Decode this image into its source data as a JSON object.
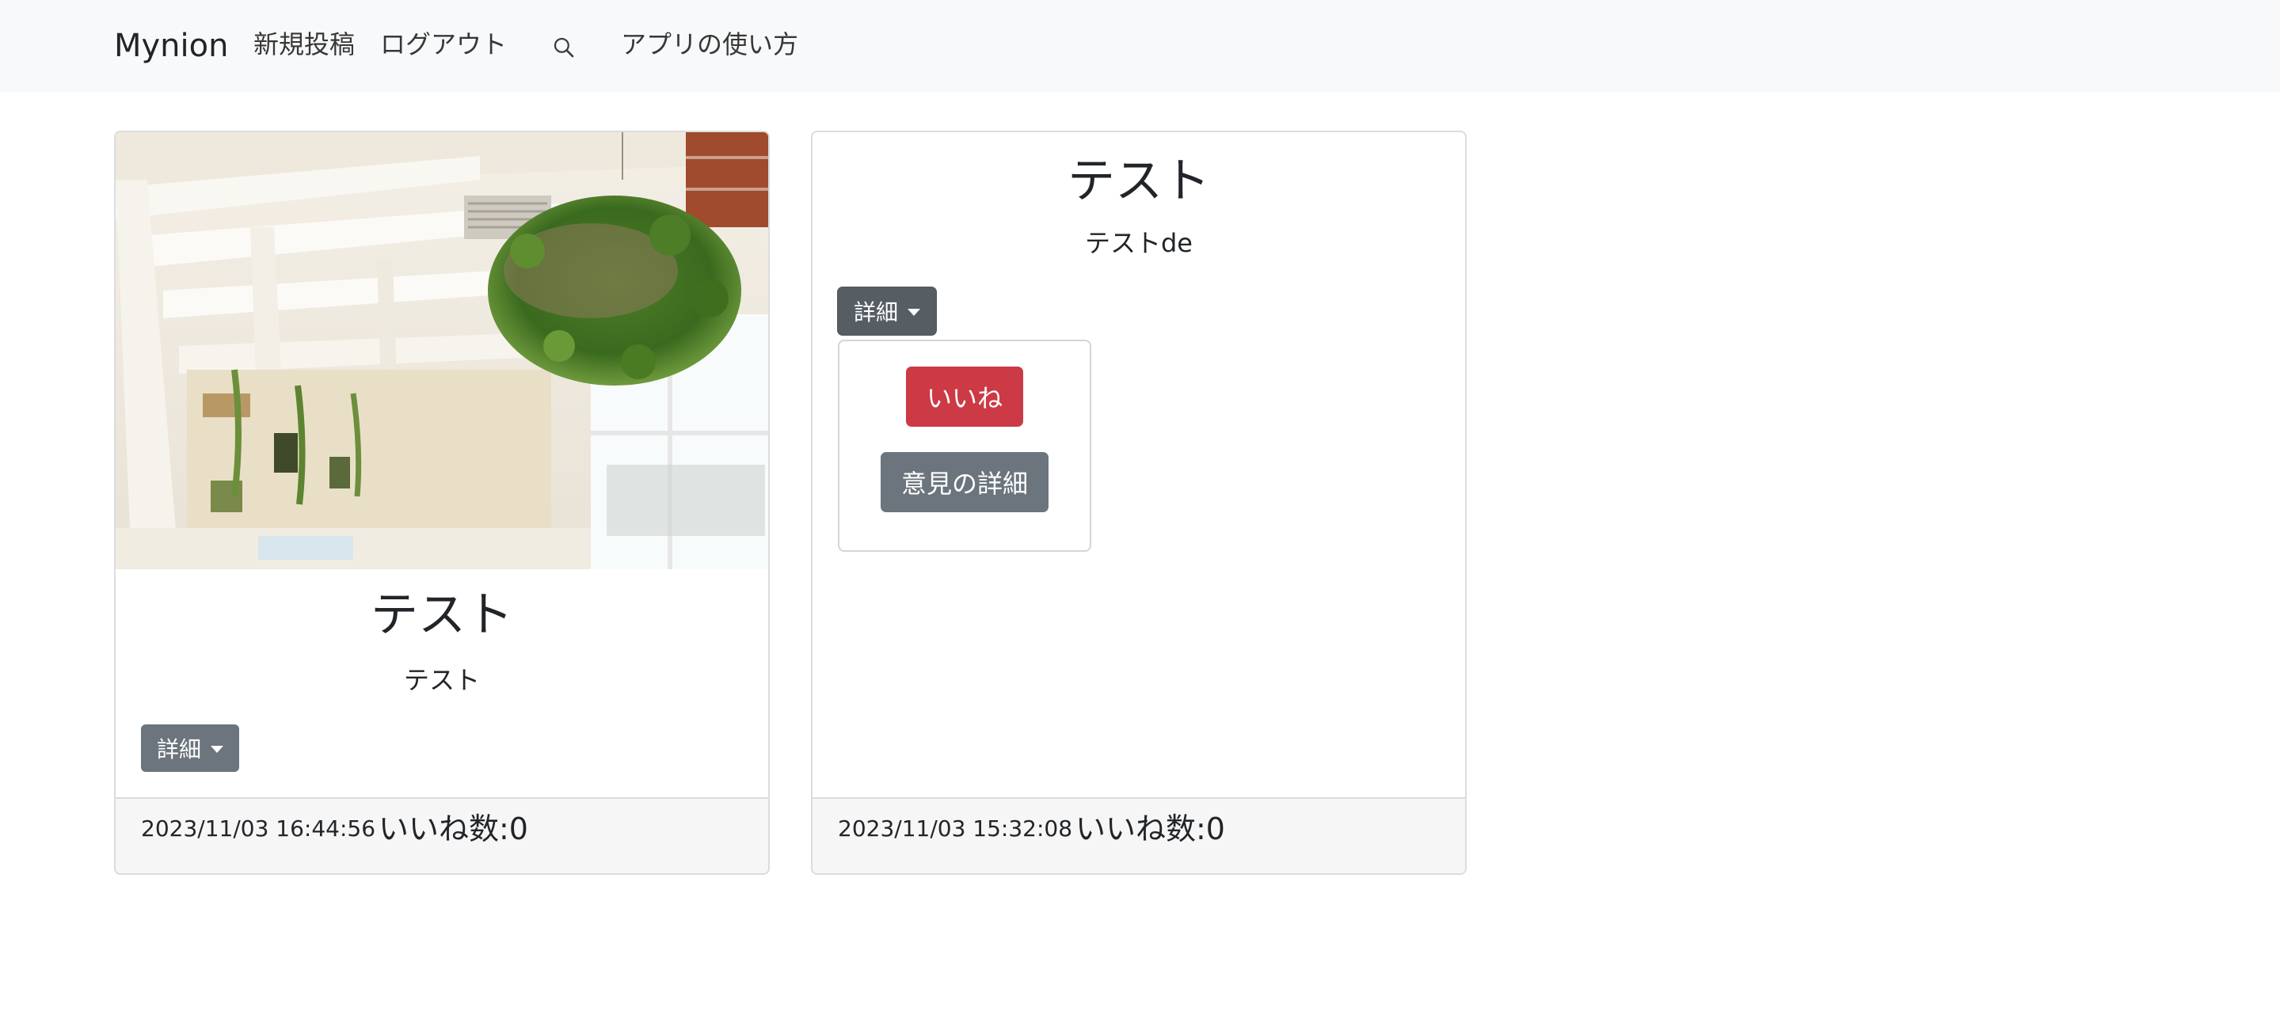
{
  "nav": {
    "brand": "Mynion",
    "new_post": "新規投稿",
    "logout": "ログアウト",
    "search_icon": "search-icon",
    "help": "アプリの使い方"
  },
  "posts": [
    {
      "title": "テスト",
      "text": "テスト",
      "detail_label": "詳細",
      "date": "2023/11/03 16:44:56",
      "likes": "いいね数:0",
      "has_image": true
    },
    {
      "title": "テスト",
      "text": "テストde",
      "detail_label": "詳細",
      "date": "2023/11/03 15:32:08",
      "likes": "いいね数:0",
      "has_image": false,
      "dropdown": {
        "open": true,
        "like_label": "いいね",
        "opinion_label": "意見の詳細"
      }
    }
  ],
  "colors": {
    "navbar_bg": "#f8f9fa",
    "secondary": "#6c757d",
    "danger": "#cc3a46",
    "footer_bg": "#f6f6f6"
  }
}
